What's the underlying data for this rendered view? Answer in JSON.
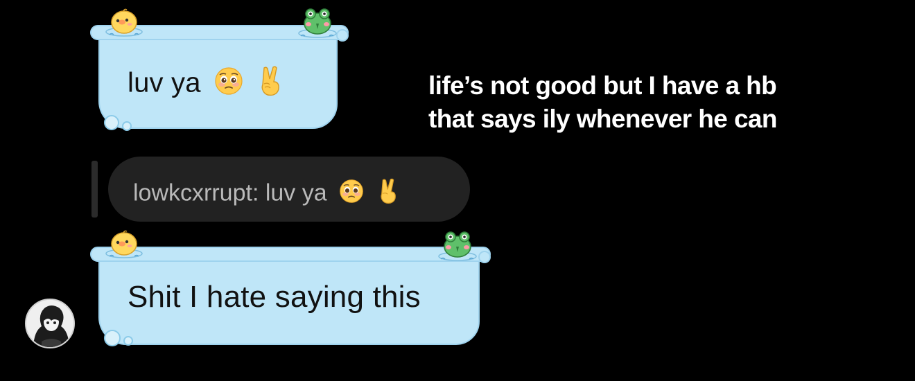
{
  "messages": [
    {
      "text": "luv ya",
      "emojis": [
        "pleading-face",
        "victory-hand"
      ]
    },
    {
      "text": "Shit I hate saying this",
      "emojis": []
    }
  ],
  "reply": {
    "sender": "lowkcxrrupt",
    "separator": ": ",
    "text": "luv ya",
    "emojis": [
      "pleading-face",
      "victory-hand"
    ]
  },
  "caption": {
    "line1": "life’s not good but I have a hb",
    "line2": "that says ily whenever he can"
  },
  "theme": {
    "bubble_color": "#bfe6f8",
    "bubble_border": "#9fd3ee",
    "background": "#000000",
    "reply_background": "#222222",
    "reply_text_color": "#b9b9b9",
    "caption_color": "#ffffff",
    "decorations": [
      "chick-icon",
      "frog-icon",
      "soap-bubble-icon"
    ]
  }
}
